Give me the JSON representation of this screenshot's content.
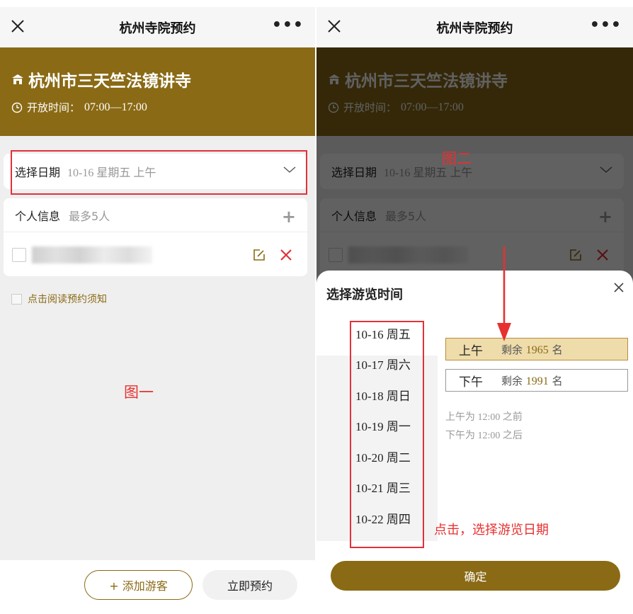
{
  "app": {
    "title": "杭州寺院预约"
  },
  "temple": {
    "name": "杭州市三天竺法镜讲寺",
    "hours_label": "开放时间：",
    "hours_value": "07:00—17:00"
  },
  "date_select": {
    "label": "选择日期",
    "value": "10-16 星期五 上午"
  },
  "personal": {
    "label": "个人信息",
    "limit": "最多5人"
  },
  "agreement": "点击阅读预约须知",
  "buttons": {
    "add_visitor": "+ 添加游客",
    "book_now": "立即预约",
    "confirm": "确定"
  },
  "annotations": {
    "fig1": "图一",
    "fig2": "图二",
    "click_hint": "点击，选择游览日期"
  },
  "sheet": {
    "title": "选择游览时间",
    "dates": [
      "10-16 周五",
      "10-17 周六",
      "10-18 周日",
      "10-19 周一",
      "10-20 周二",
      "10-21 周三",
      "10-22 周四"
    ],
    "slots": [
      {
        "name": "上午",
        "remaining_prefix": "剩余",
        "remaining": "1965",
        "suffix": "名",
        "selected": true
      },
      {
        "name": "下午",
        "remaining_prefix": "剩余",
        "remaining": "1991",
        "suffix": "名",
        "selected": false
      }
    ],
    "notes": [
      "上午为 12:00 之前",
      "下午为 12:00 之后"
    ]
  },
  "colors": {
    "brand": "#8a6a15",
    "annotation": "#e2313a",
    "selected_slot": "#efdcab"
  }
}
